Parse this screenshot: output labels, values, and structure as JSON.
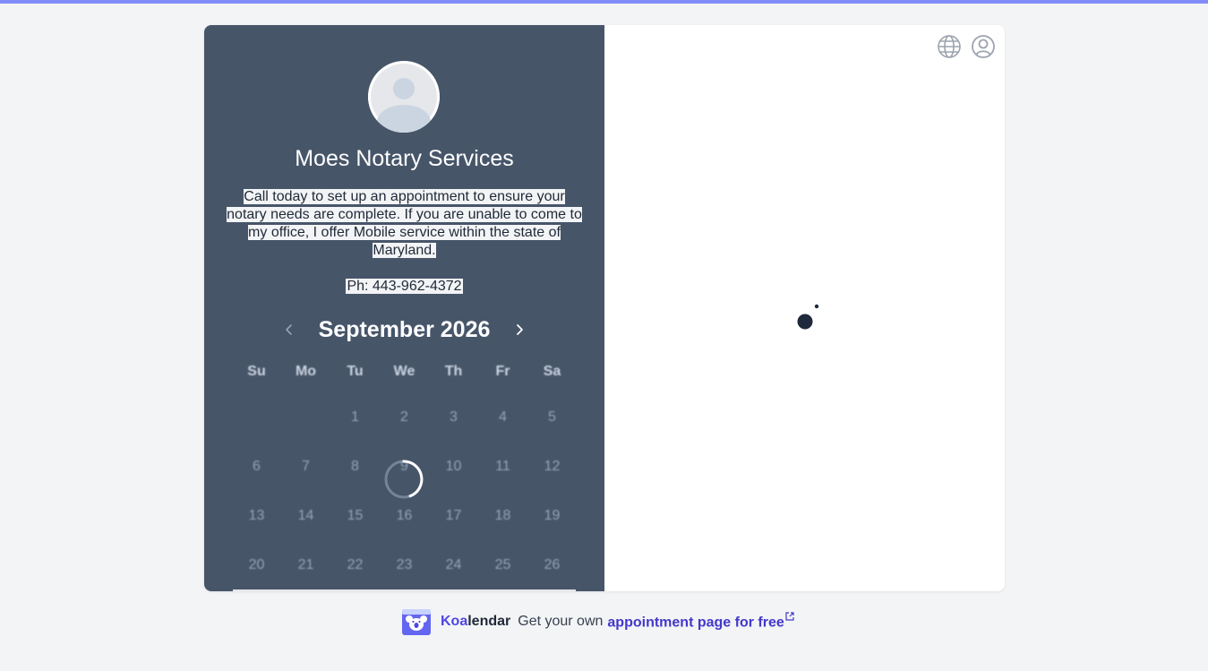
{
  "colors": {
    "top_bar": "#818cf8",
    "panel_bg": "#475569",
    "page_bg": "#f3f4f6",
    "brand_accent": "#4f46e5"
  },
  "profile": {
    "business_name": "Moes Notary Services",
    "description": "Call today to set up an appointment to ensure your notary needs are complete. If you are unable to come to my office, I offer Mobile service within the state of Maryland.",
    "phone": "Ph: 443-962-4372",
    "avatar_icon": "user-avatar-placeholder"
  },
  "calendar": {
    "month_title": "September 2026",
    "prev_icon": "chevron-left-icon",
    "next_icon": "chevron-right-icon",
    "weekdays": [
      "Su",
      "Mo",
      "Tu",
      "We",
      "Th",
      "Fr",
      "Sa"
    ],
    "days": [
      "",
      "",
      "1",
      "2",
      "3",
      "4",
      "5",
      "6",
      "7",
      "8",
      "9",
      "10",
      "11",
      "12",
      "13",
      "14",
      "15",
      "16",
      "17",
      "18",
      "19",
      "20",
      "21",
      "22",
      "23",
      "24",
      "25",
      "26"
    ],
    "loading_icon": "spinner-icon"
  },
  "header_icons": {
    "language": "globe-icon",
    "account": "user-circle-icon"
  },
  "footer": {
    "brand_koa": "Koa",
    "brand_rest": "lendar",
    "text": "Get your own",
    "link": "appointment page for free"
  }
}
